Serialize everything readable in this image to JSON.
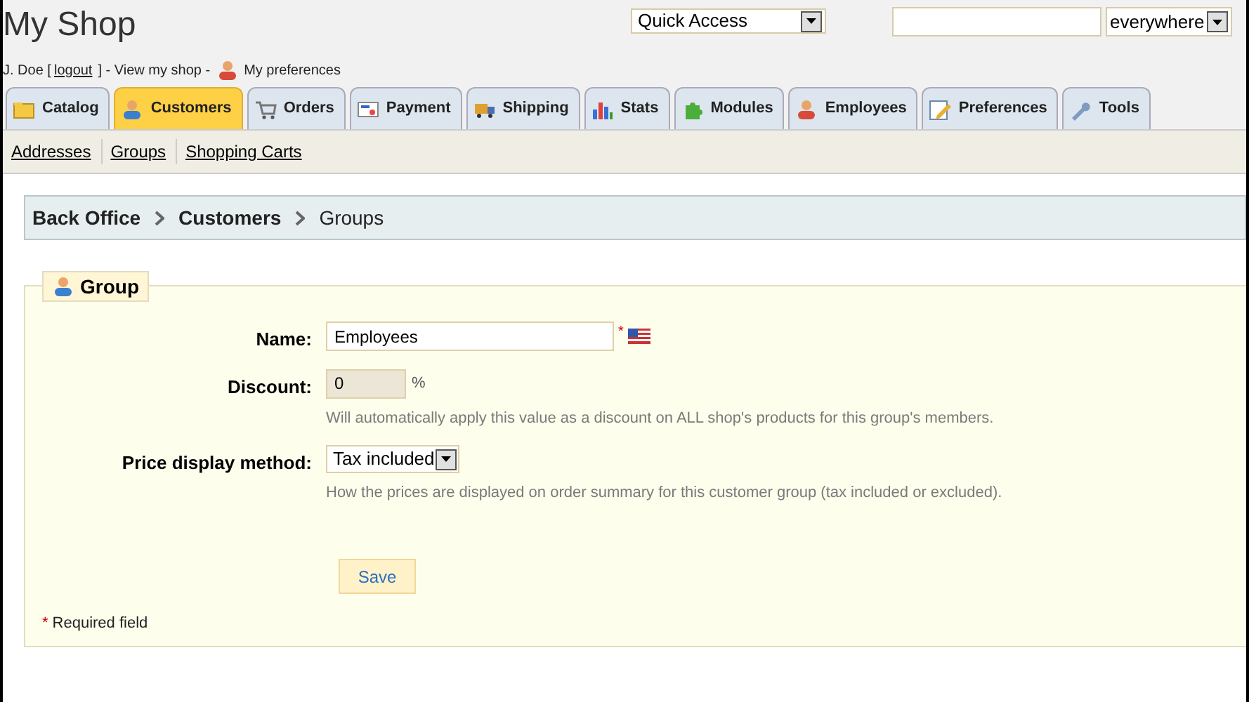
{
  "header": {
    "title": "My Shop",
    "user": "J. Doe [",
    "logout": "logout",
    "middle": "] - View my shop -",
    "preferences": "My preferences",
    "quick_access": "Quick Access",
    "search_scope": "everywhere"
  },
  "tabs": [
    {
      "label": "Catalog",
      "selected": false
    },
    {
      "label": "Customers",
      "selected": true
    },
    {
      "label": "Orders",
      "selected": false
    },
    {
      "label": "Payment",
      "selected": false
    },
    {
      "label": "Shipping",
      "selected": false
    },
    {
      "label": "Stats",
      "selected": false
    },
    {
      "label": "Modules",
      "selected": false
    },
    {
      "label": "Employees",
      "selected": false
    },
    {
      "label": "Preferences",
      "selected": false
    },
    {
      "label": "Tools",
      "selected": false
    }
  ],
  "subtabs": [
    "Addresses",
    "Groups",
    "Shopping Carts"
  ],
  "breadcrumb": [
    "Back Office",
    "Customers",
    "Groups"
  ],
  "form": {
    "legend": "Group",
    "fields": [
      {
        "kind": "text",
        "label": "Name:",
        "value": "Employees",
        "required_mark": "*"
      },
      {
        "kind": "number",
        "label": "Discount:",
        "value": "0",
        "unit": "%",
        "hint": "Will automatically apply this value as a discount on ALL shop's products for this group's members."
      },
      {
        "kind": "select",
        "label": "Price display method:",
        "value": "Tax included",
        "hint": "How the prices are displayed on order summary for this customer group (tax included or excluded)."
      }
    ],
    "save": "Save",
    "required_note": "Required field",
    "required_star": "*"
  }
}
